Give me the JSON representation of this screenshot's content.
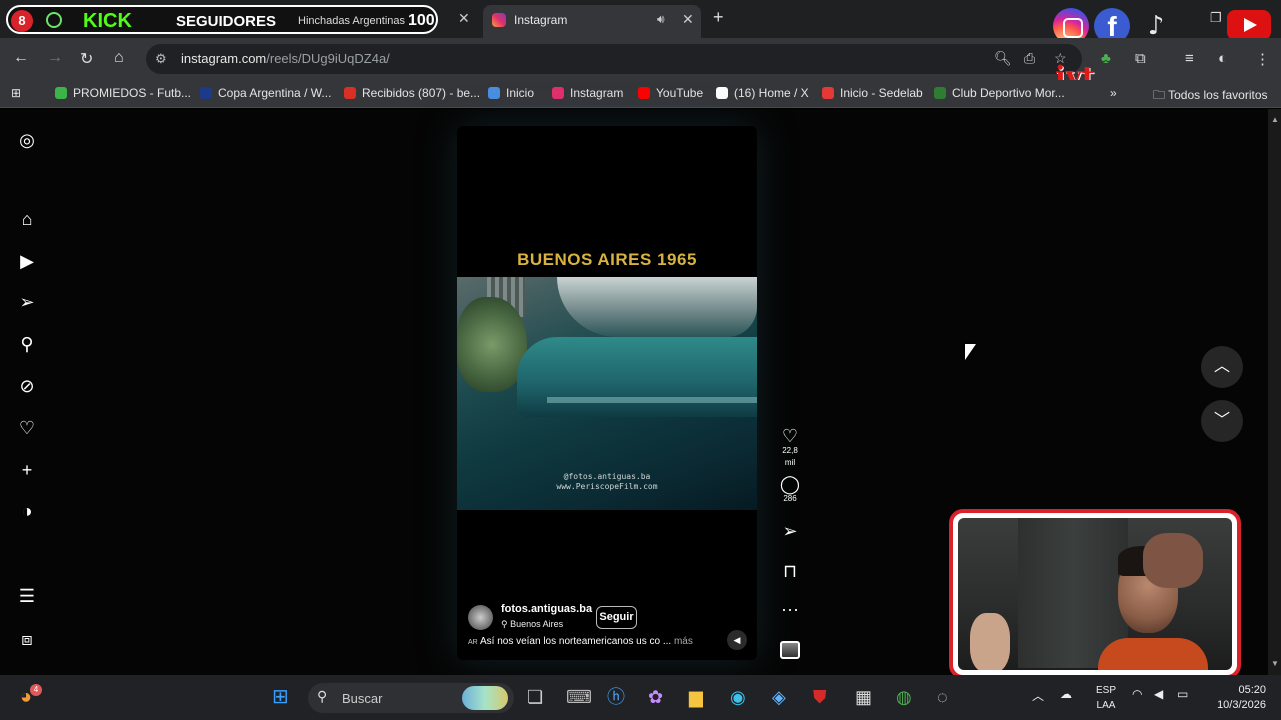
{
  "browser": {
    "overlay": {
      "badge_number": "8",
      "kick_text": "KICK",
      "seguidores_text": "SEGUIDORES",
      "tab_title": "Hinchadas Argentinas",
      "hundred_text": "100"
    },
    "active_tab": {
      "title": "Instagram"
    },
    "url": {
      "host": "instagram.com",
      "path": "/reels/DUg9iUqDZ4a/"
    },
    "bookmarks": [
      {
        "label": "PROMIEDOS - Futb...",
        "color": "#3bb54a"
      },
      {
        "label": "Copa Argentina / W...",
        "color": "#1c3a8a"
      },
      {
        "label": "Recibidos (807) - be...",
        "color": "#d93025"
      },
      {
        "label": "Inicio",
        "color": "#4a90e2"
      },
      {
        "label": "Instagram",
        "color": "#e1306c"
      },
      {
        "label": "YouTube",
        "color": "#ff0000"
      },
      {
        "label": "(16) Home / X",
        "color": "#ffffff"
      },
      {
        "label": "Inicio - Sedelab",
        "color": "#e53935"
      },
      {
        "label": "Club Deportivo Mor...",
        "color": "#2e7d32"
      }
    ],
    "bookmarks_more": "»",
    "all_favorites": "Todos los favoritos",
    "overlay_brand": "iyt"
  },
  "reel": {
    "title": "BUENOS AIRES  1965",
    "watermark_1": "@fotos.antiguas.ba",
    "watermark_2": "www.PeriscopeFilm.com",
    "username": "fotos.antiguas.ba",
    "location": "Buenos Aires",
    "follow_label": "Seguir",
    "caption_tag": "AR",
    "caption": "Así nos veían los norteamericanos us co ...",
    "more_label": "más"
  },
  "actions": {
    "likes": "22,8 mil",
    "comments": "286",
    "more": "···"
  },
  "taskbar": {
    "search_label": "Buscar",
    "notification_count": "4",
    "lang_1": "ESP",
    "lang_2": "LAA",
    "time": "05:20",
    "date": "10/3/2026"
  }
}
